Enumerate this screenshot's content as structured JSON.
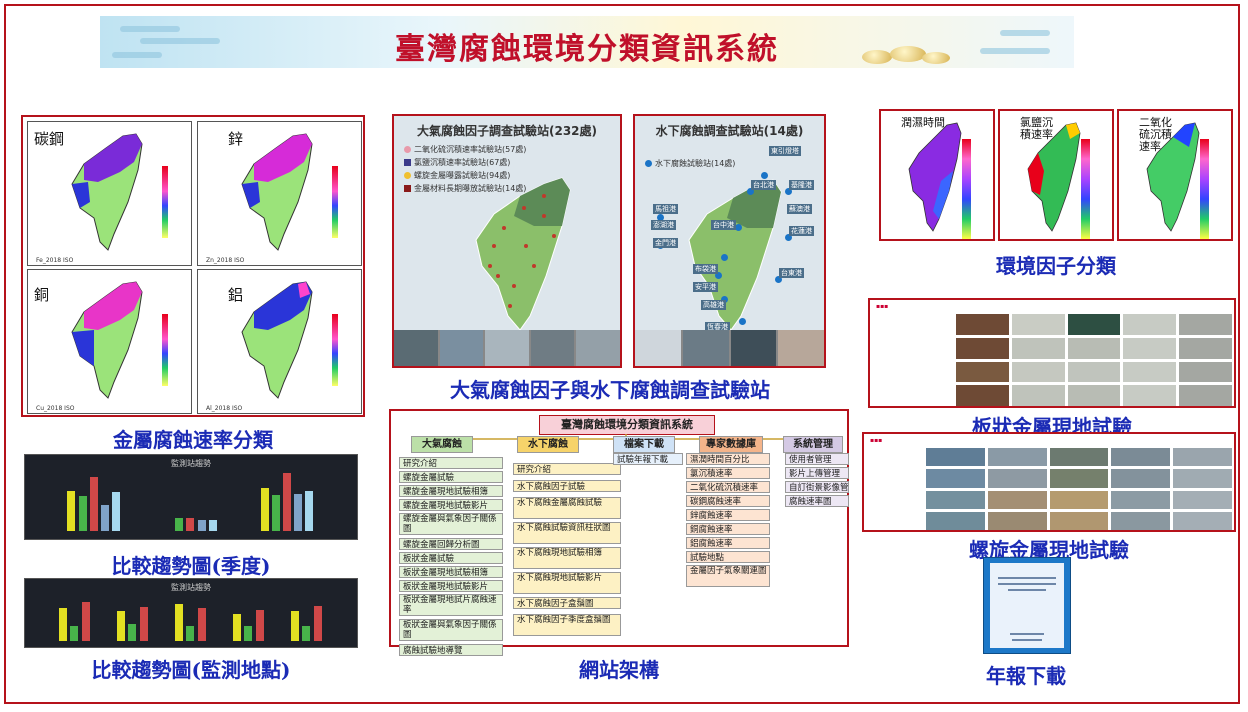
{
  "banner": {
    "title": "臺灣腐蝕環境分類資訊系統"
  },
  "metal_maps": {
    "caption": "金屬腐蝕速率分類",
    "maps": [
      {
        "metal": "碳鋼",
        "footer": "Fe_2018 ISO"
      },
      {
        "metal": "鋅",
        "footer": "Zn_2018 ISO"
      },
      {
        "metal": "銅",
        "footer": "Cu_2018 ISO"
      },
      {
        "metal": "鋁",
        "footer": "Al_2018 ISO"
      }
    ]
  },
  "trend_season": {
    "caption": "比較趨勢圖(季度)",
    "chart_title": "監測站趨勢"
  },
  "trend_site": {
    "caption": "比較趨勢圖(監測地點)",
    "chart_title": "監測站趨勢"
  },
  "atmo_station": {
    "header": "大氣腐蝕因子調查試驗站(232處)",
    "legend": [
      "二氧化硫沉積速率試驗站(57處)",
      "氯鹽沉積速率試驗站(67處)",
      "螺旋金屬曝露試驗站(94處)",
      "金屬材料長期曝放試驗站(14處)"
    ],
    "legend_colors": [
      "#e89aaa",
      "#3a3a8a",
      "#f0c030",
      "#8a1a1a"
    ]
  },
  "water_station": {
    "header": "水下腐蝕調查試驗站(14處)",
    "legend": [
      "水下腐蝕試驗站(14處)"
    ],
    "places": [
      "東引燈塔",
      "台北港",
      "基隆港",
      "澎湖港",
      "台中港",
      "花蓮港",
      "布袋港",
      "安平港",
      "高雄港",
      "蘇澳港",
      "馬祖港",
      "金門港",
      "台東港",
      "恆春港"
    ]
  },
  "stations_caption": "大氣腐蝕因子與水下腐蝕調查試驗站",
  "sitemap": {
    "caption": "網站架構",
    "root": "臺灣腐蝕環境分類資訊系統",
    "columns": [
      {
        "title": "大氣腐蝕",
        "items": [
          "研究介紹",
          "螺旋金屬試驗",
          "螺旋金屬現地試驗相簿",
          "螺旋金屬現地試驗影片",
          "螺旋金屬與氣象因子關係圖",
          "螺旋金屬回歸分析圖",
          "板狀金屬試驗",
          "板狀金屬現地試驗相簿",
          "板狀金屬現地試驗影片",
          "板狀金屬現地試片腐蝕速率",
          "板狀金屬與氣象因子關係圖",
          "腐蝕試驗地導覽"
        ]
      },
      {
        "title": "水下腐蝕",
        "items": [
          "研究介紹",
          "水下腐蝕因子試驗",
          "水下腐蝕金屬腐蝕試驗",
          "水下腐蝕試驗資訊柱狀圖",
          "水下腐蝕現地試驗相簿",
          "水下腐蝕現地試驗影片",
          "水下腐蝕因子盒鬚圖",
          "水下腐蝕因子季度盒鬚圖"
        ]
      },
      {
        "title": "檔案下載",
        "items": [
          "試驗年報下載"
        ]
      },
      {
        "title": "專家數據庫",
        "items": [
          "濕潤時間百分比",
          "氯沉積速率",
          "二氧化硫沉積速率",
          "碳鋼腐蝕速率",
          "鋅腐蝕速率",
          "銅腐蝕速率",
          "鋁腐蝕速率",
          "試驗地點",
          "金屬因子氣象關連圖"
        ]
      },
      {
        "title": "系統管理",
        "items": [
          "使用者管理",
          "影片上傳管理",
          "自訂街景影像管理",
          "腐蝕速率圖"
        ]
      }
    ]
  },
  "env_factors": {
    "caption": "環境因子分類",
    "maps": [
      {
        "label": "潤濕時間"
      },
      {
        "label": "氯鹽沉積速率"
      },
      {
        "label": "二氧化硫沉積速率"
      }
    ]
  },
  "plate_test": {
    "caption": "板狀金屬現地試驗"
  },
  "spiral_test": {
    "caption": "螺旋金屬現地試驗"
  },
  "report": {
    "caption": "年報下載"
  },
  "chart_data": [
    {
      "type": "bar",
      "title": "監測站趨勢",
      "categories": [
        "1",
        "2",
        "3"
      ],
      "series": [
        {
          "values": [
            52,
            0,
            55
          ]
        },
        {
          "values": [
            45,
            17,
            47
          ]
        },
        {
          "values": [
            70,
            17,
            75
          ]
        },
        {
          "values": [
            33,
            14,
            48
          ]
        },
        {
          "values": [
            50,
            14,
            52
          ]
        }
      ],
      "colors": [
        "#e3e022",
        "#48b44a",
        "#d04848",
        "#7fa3c9",
        "#a6d8ee"
      ]
    },
    {
      "type": "bar",
      "title": "監測站趨勢",
      "categories": [
        "1",
        "2",
        "3",
        "4",
        "5"
      ],
      "series": [
        {
          "values": [
            55,
            50,
            62,
            45,
            50
          ]
        },
        {
          "values": [
            25,
            28,
            25,
            25,
            25
          ]
        },
        {
          "values": [
            65,
            57,
            55,
            52,
            58
          ]
        }
      ],
      "colors": [
        "#e3e022",
        "#48b44a",
        "#d04848"
      ]
    }
  ]
}
